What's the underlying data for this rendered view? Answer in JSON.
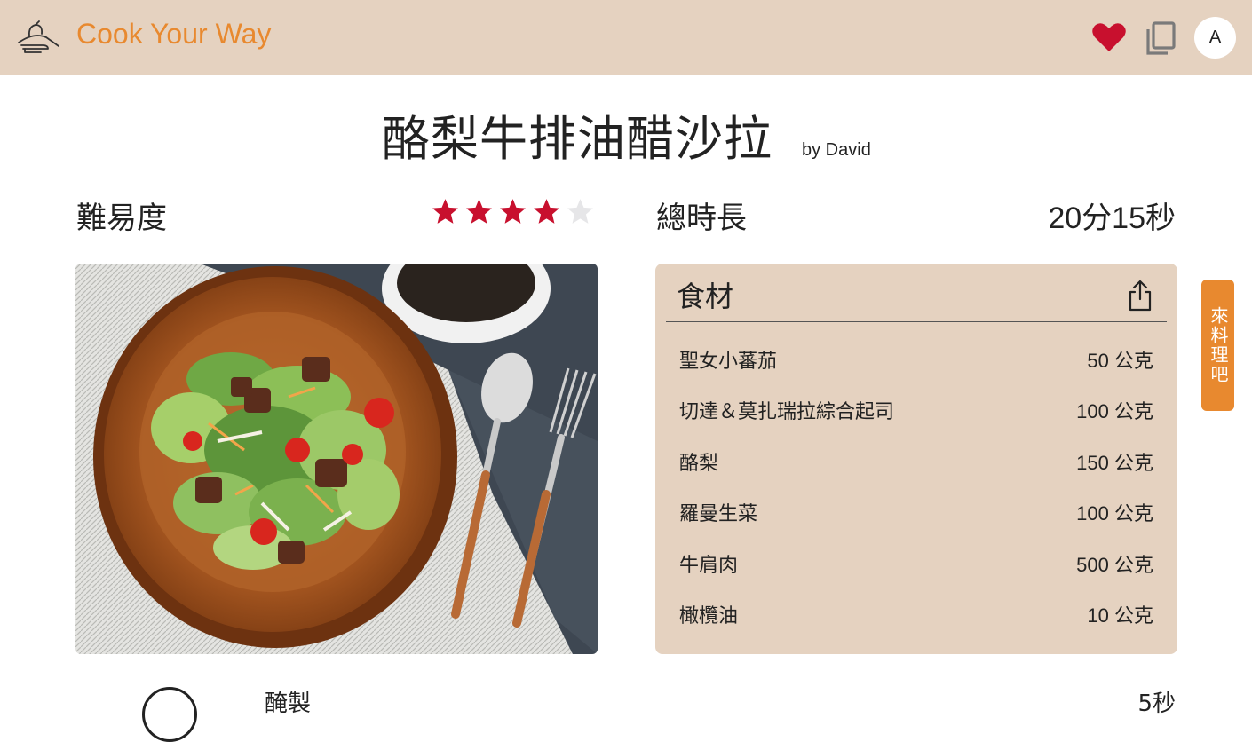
{
  "header": {
    "logo_icon": "chef-hand-icon",
    "app_title": "Cook Your Way",
    "favorite_icon": "heart-icon",
    "copy_icon": "copy-icon",
    "avatar_initial": "A"
  },
  "recipe": {
    "title": "酪梨牛排油醋沙拉",
    "author": "by David",
    "difficulty_label": "難易度",
    "difficulty_rating": 4,
    "difficulty_max": 5,
    "total_time_label": "總時長",
    "total_time_value": "20分15秒"
  },
  "colors": {
    "header_bg": "#e5d2c0",
    "accent_orange": "#e8892f",
    "star_filled": "#c8102e",
    "star_empty": "#e6e6e8",
    "heart": "#c8102e"
  },
  "ingredients": {
    "title": "食材",
    "share_icon": "share-icon",
    "items": [
      {
        "name": "聖女小蕃茄",
        "amount": "50 公克"
      },
      {
        "name": "切達＆莫扎瑞拉綜合起司",
        "amount": "100 公克"
      },
      {
        "name": "酪梨",
        "amount": "150 公克"
      },
      {
        "name": "羅曼生菜",
        "amount": "100 公克"
      },
      {
        "name": "牛肩肉",
        "amount": "500 公克"
      },
      {
        "name": "橄欖油",
        "amount": "10 公克"
      }
    ]
  },
  "side_tab": {
    "label": "來料理吧"
  },
  "steps": {
    "first_label": "醃製",
    "first_time": "5秒"
  }
}
